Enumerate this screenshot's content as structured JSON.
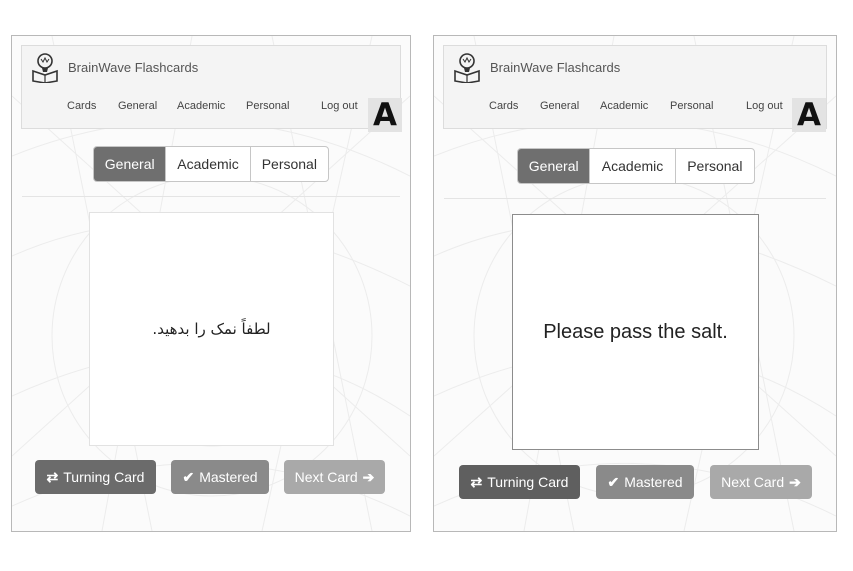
{
  "app": {
    "title": "BrainWave Flashcards"
  },
  "nav": {
    "cards": "Cards",
    "general": "General",
    "academic": "Academic",
    "personal": "Personal",
    "logout": "Log out",
    "avatar_letter": "A"
  },
  "categories": {
    "general": "General",
    "academic": "Academic",
    "personal": "Personal",
    "active": "General"
  },
  "left_screen": {
    "card_text": "لطفاً نمک را بدهید."
  },
  "right_screen": {
    "card_text": "Please pass the salt."
  },
  "buttons": {
    "turning": "Turning Card",
    "mastered": "Mastered",
    "next": "Next Card"
  },
  "icons": {
    "turning": "exchange-arrows-icon",
    "mastered": "check-icon",
    "next": "arrow-right-icon"
  },
  "colors": {
    "dark_button": "#6b6b6b",
    "mid_button": "#8a8a8a",
    "light_button": "#a9a9a9",
    "active_tab": "#6f6f6f"
  }
}
